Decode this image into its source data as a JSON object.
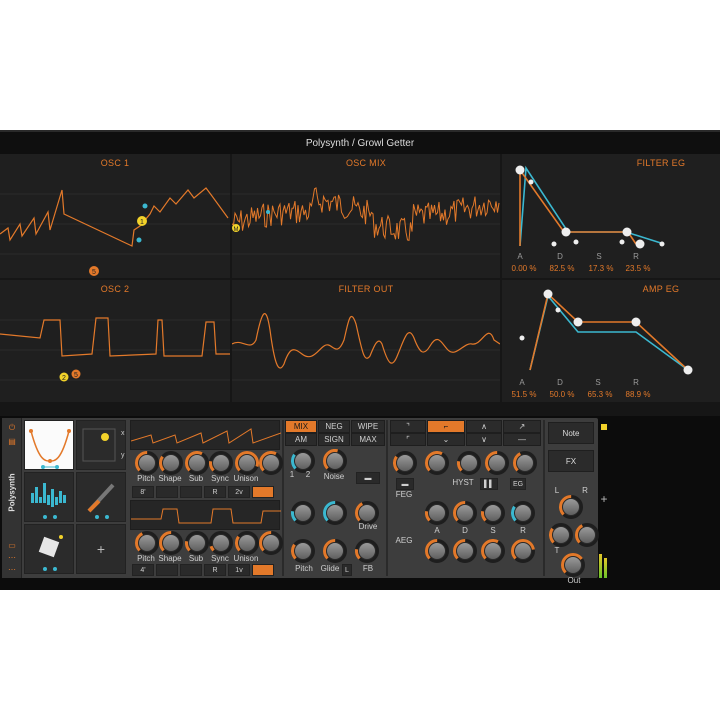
{
  "window": {
    "title": "Polysynth / Growl Getter"
  },
  "panels": {
    "osc1": {
      "title": "OSC 1",
      "markers": [
        "1",
        "5"
      ]
    },
    "osc_mix": {
      "title": "OSC MIX",
      "markers": [
        "M"
      ]
    },
    "filter_eg": {
      "title": "FILTER EG",
      "stages": [
        "A",
        "D",
        "S",
        "R"
      ],
      "values": [
        "0.00 %",
        "82.5 %",
        "17.3 %",
        "23.5 %"
      ]
    },
    "osc2": {
      "title": "OSC 2",
      "markers": [
        "2",
        "5"
      ]
    },
    "filter_out": {
      "title": "FILTER OUT"
    },
    "amp_eg": {
      "title": "AMP EG",
      "stages": [
        "A",
        "D",
        "S",
        "R"
      ],
      "values": [
        "51.5 %",
        "50.0 %",
        "65.3 %",
        "88.9 %"
      ]
    }
  },
  "device": {
    "name": "Polysynth",
    "osc1_knobs": [
      "Pitch",
      "Shape",
      "Sub",
      "Sync",
      "Unison"
    ],
    "osc1_values": [
      "8'",
      "",
      "",
      "R",
      "2v",
      ""
    ],
    "osc2_knobs": [
      "Pitch",
      "Shape",
      "Sub",
      "Unison"
    ],
    "osc2_sync_label": "Sync",
    "osc2_values": [
      "4'",
      "",
      "",
      "R",
      "1v",
      ""
    ],
    "mix_modes_row1": [
      "MIX",
      "NEG",
      "WIPE"
    ],
    "mix_modes_row2": [
      "AM",
      "SIGN",
      "MAX"
    ],
    "mix_knob_labels": {
      "one": "1",
      "two": "2",
      "noise": "Noise",
      "drive": "Drive",
      "pitch": "Pitch",
      "glide": "Glide",
      "fb": "FB",
      "glide_badge": "L"
    },
    "filter_labels": {
      "hyst": "HYST",
      "feg": "FEG",
      "aeg": "AEG",
      "a": "A",
      "d": "D",
      "s": "S",
      "r": "R",
      "eg_badge": "EG"
    },
    "right": {
      "note": "Note",
      "fx": "FX",
      "l": "L",
      "r": "R",
      "out": "Out",
      "plus": "+",
      "t": "T"
    }
  },
  "colors": {
    "accent": "#e3792a",
    "secondary": "#3bb8d0",
    "bg": "#1f1f1f"
  }
}
